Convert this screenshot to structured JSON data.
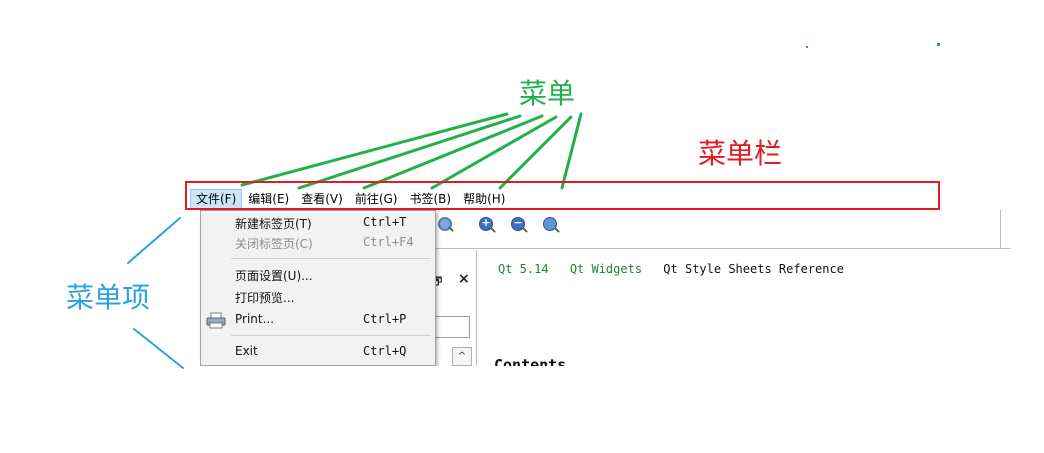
{
  "annotations": {
    "menu": "菜单",
    "menubar": "菜单栏",
    "menu_item": "菜单项"
  },
  "colors": {
    "menu_annotation": "#22b04b",
    "menubar_annotation": "#e11b22",
    "menu_item_annotation": "#2aa2dd"
  },
  "menubar": {
    "items": [
      {
        "label": "文件(F)",
        "active": true
      },
      {
        "label": "编辑(E)"
      },
      {
        "label": "查看(V)"
      },
      {
        "label": "前往(G)"
      },
      {
        "label": "书签(B)"
      },
      {
        "label": "帮助(H)"
      }
    ]
  },
  "toolbar": {
    "icons": [
      "home-icon",
      "zoom-in-icon",
      "zoom-out-icon",
      "zoom-reset-icon"
    ]
  },
  "dropdown": {
    "items": [
      {
        "label": "新建标签页(T)",
        "shortcut": "Ctrl+T",
        "enabled": true
      },
      {
        "label": "关闭标签页(C)",
        "shortcut": "Ctrl+F4",
        "enabled": false
      },
      {
        "label": "页面设置(U)...",
        "shortcut": "",
        "enabled": true
      },
      {
        "label": "打印预览...",
        "shortcut": "",
        "enabled": true
      },
      {
        "label": "Print...",
        "shortcut": "Ctrl+P",
        "enabled": true,
        "icon": "printer-icon"
      },
      {
        "label": "Exit",
        "shortcut": "Ctrl+Q",
        "enabled": true
      }
    ]
  },
  "content": {
    "breadcrumbs": [
      "Qt 5.14",
      "Qt Widgets"
    ],
    "current": "Qt Style Sheets Reference",
    "heading": "Contents"
  },
  "dock": {
    "float_glyph": "🗗",
    "close_glyph": "×",
    "scroll_up_glyph": "^"
  }
}
